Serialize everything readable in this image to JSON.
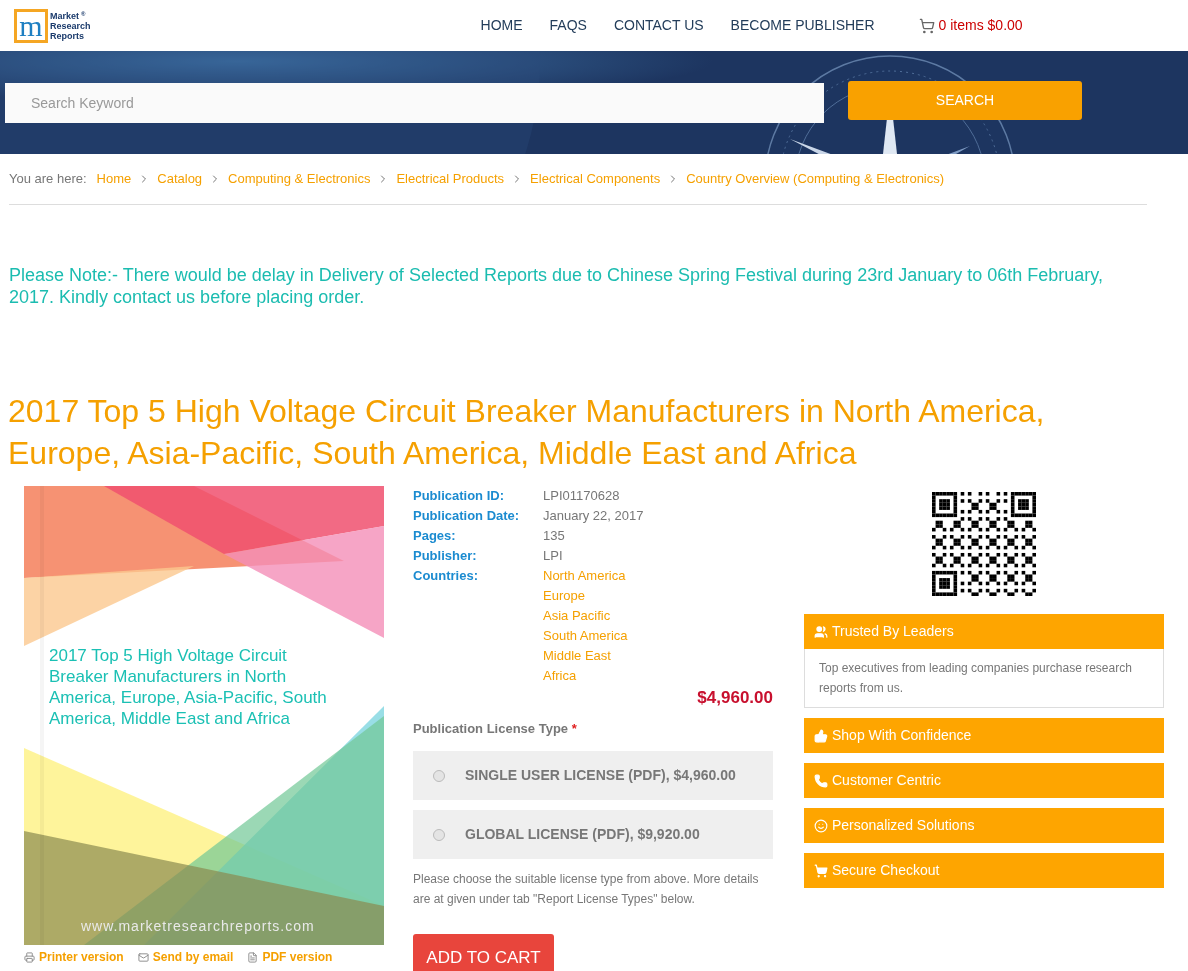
{
  "header": {
    "logo_letter": "m",
    "logo_lines": [
      "Market",
      "Research",
      "Reports"
    ],
    "logo_mark": "®",
    "nav": [
      {
        "label": "HOME"
      },
      {
        "label": "FAQS"
      },
      {
        "label": "CONTACT US"
      },
      {
        "label": "BECOME PUBLISHER"
      }
    ],
    "cart": "0 items $0.00"
  },
  "search": {
    "placeholder": "Search Keyword",
    "button": "SEARCH"
  },
  "breadcrumb": {
    "label": "You are here:",
    "items": [
      "Home",
      "Catalog",
      "Computing & Electronics",
      "Electrical Products",
      "Electrical Components",
      "Country Overview (Computing & Electronics)"
    ]
  },
  "notice": "Please Note:- There would be delay in Delivery of Selected Reports due to Chinese Spring Festival during 23rd January to 06th February, 2017. Kindly contact us before placing order.",
  "title": "2017 Top 5 High Voltage Circuit Breaker Manufacturers in North America, Europe, Asia-Pacific, South America, Middle East and Africa",
  "cover": {
    "title": "2017 Top 5 High Voltage Circuit Breaker Manufacturers in North America, Europe, Asia-Pacific, South America, Middle East and Africa",
    "url": "www.marketresearchreports.com"
  },
  "cover_links": [
    {
      "kind": "print",
      "label": "Printer version"
    },
    {
      "kind": "email",
      "label": "Send by email"
    },
    {
      "kind": "pdf",
      "label": "PDF version"
    }
  ],
  "details": [
    {
      "label": "Publication ID:",
      "values": [
        "LPI01170628"
      ],
      "kind": "text"
    },
    {
      "label": "Publication Date:",
      "values": [
        "January 22, 2017"
      ],
      "kind": "text"
    },
    {
      "label": "Pages:",
      "values": [
        "135"
      ],
      "kind": "text"
    },
    {
      "label": "Publisher:",
      "values": [
        "LPI"
      ],
      "kind": "text"
    },
    {
      "label": "Countries:",
      "values": [
        "North America",
        "Europe",
        "Asia Pacific",
        "South America",
        "Middle East",
        "Africa"
      ],
      "kind": "link"
    }
  ],
  "price": "$4,960.00",
  "license": {
    "label": "Publication License Type",
    "required": "*",
    "options": [
      {
        "label": "SINGLE USER LICENSE (PDF), $4,960.00",
        "selected": false
      },
      {
        "label": "GLOBAL LICENSE (PDF), $9,920.00",
        "selected": false
      }
    ],
    "note": "Please choose the suitable license type from above. More details are at given under tab \"Report License Types\" below."
  },
  "add_to_cart": "ADD TO CART",
  "panels": [
    {
      "kind": "users",
      "title": "Trusted By Leaders",
      "body": "Top executives from leading companies purchase research reports from us."
    },
    {
      "kind": "thumb",
      "title": "Shop With Confidence"
    },
    {
      "kind": "phone",
      "title": "Customer Centric"
    },
    {
      "kind": "smile",
      "title": "Personalized Solutions"
    },
    {
      "kind": "cart",
      "title": "Secure Checkout"
    }
  ]
}
